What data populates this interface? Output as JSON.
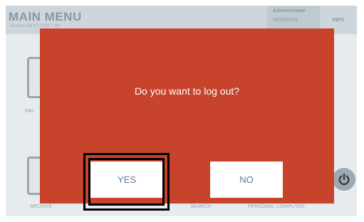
{
  "header": {
    "title": "MAIN MENU",
    "subtitle": "Version GW 3.0.0 OK 1.84",
    "user": "Administrator",
    "date": "06/03/2015",
    "info_label": "INFO"
  },
  "tiles": {
    "favorites_label": "FAV",
    "archive_label": "ARCHIVE",
    "search_label": "SEARCH",
    "personal_computer_label": "PERSONAL COMPUTER"
  },
  "dialog": {
    "message": "Do you want to log out?",
    "yes_label": "YES",
    "no_label": "NO"
  },
  "colors": {
    "dialog_background": "#c7432b",
    "button_text": "#5c7a93",
    "highlight_border": "#000000"
  }
}
